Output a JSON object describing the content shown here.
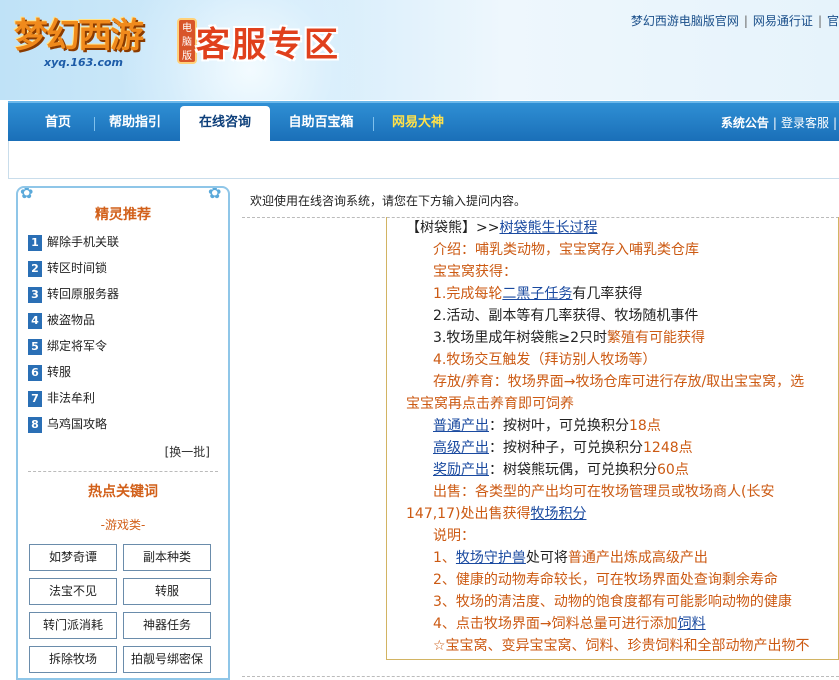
{
  "header": {
    "logo_text": "梦幻西游",
    "logo_url": "xyq.163.com",
    "logo_badge": "电脑版",
    "zone_title": "客服专区",
    "top_links": [
      "梦幻西游电脑版官网",
      "网易通行证",
      "官"
    ]
  },
  "nav": {
    "tabs": [
      {
        "label": "首页"
      },
      {
        "label": "帮助指引"
      },
      {
        "label": "在线咨询"
      },
      {
        "label": "自助百宝箱"
      },
      {
        "label": "网易大神"
      }
    ],
    "active_tab": "在线咨询",
    "right_links": [
      "系统公告",
      "登录客服"
    ]
  },
  "sidebar": {
    "sprite_title": "精灵推荐",
    "recommendations": [
      {
        "num": "1",
        "label": "解除手机关联"
      },
      {
        "num": "2",
        "label": "转区时间锁"
      },
      {
        "num": "3",
        "label": "转回原服务器"
      },
      {
        "num": "4",
        "label": "被盗物品"
      },
      {
        "num": "5",
        "label": "绑定将军令"
      },
      {
        "num": "6",
        "label": "转服"
      },
      {
        "num": "7",
        "label": "非法牟利"
      },
      {
        "num": "8",
        "label": "乌鸡国攻略"
      }
    ],
    "refresh_label": "[换一批]",
    "hot_title": "热点关键词",
    "game_category": "-游戏类-",
    "keywords": [
      "如梦奇谭",
      "副本种类",
      "法宝不见",
      "转服",
      "转门派消耗",
      "神器任务",
      "拆除牧场",
      "拍靓号绑密保"
    ]
  },
  "main": {
    "welcome": "欢迎使用在线咨询系统，请您在下方输入提问内容。",
    "answer": {
      "l1a": "【树袋熊】>>",
      "l1b": "树袋熊生长过程",
      "l2": "介绍：哺乳类动物，宝宝窝存入哺乳类仓库",
      "l3": "宝宝窝获得：",
      "l4a": "1.完成每轮",
      "l4b": "二黑子任务",
      "l4c": "有几率获得",
      "l5": "2.活动、副本等有几率获得、牧场随机事件",
      "l6a": "3.牧场里成年树袋熊≥2只时",
      "l6b": "繁殖有可能获得",
      "l7": "4.牧场交互触发（拜访别人牧场等）",
      "l8": "存放/养育：牧场界面→牧场仓库可进行存放/取出宝宝窝，选",
      "l9": "宝宝窝再点击养育即可饲养",
      "l10a": "普通产出",
      "l10b": "：按树叶，可兑换积分",
      "l10c": "18点",
      "l11a": "高级产出",
      "l11b": "：按树种子，可兑换积分",
      "l11c": "1248点",
      "l12a": "奖励产出",
      "l12b": "：树袋熊玩偶，可兑换积分",
      "l12c": "60点",
      "l13": "出售：各类型的产出均可在牧场管理员或牧场商人(长安",
      "l14a": "147,17)处出售获得",
      "l14b": "牧场积分",
      "l15": "说明：",
      "l16a": "1、",
      "l16b": "牧场守护兽",
      "l16c": "处可将",
      "l16d": "普通产出炼成高级产出",
      "l17": "2、健康的动物寿命较长，可在牧场界面处查询剩余寿命",
      "l18": "3、牧场的清洁度、动物的饱食度都有可能影响动物的健康",
      "l19a": "4、点击牧场界面→饲料总量可进行添加",
      "l19b": "饲料",
      "l20": "☆宝宝窝、变异宝宝窝、饲料、珍贵饲料和全部动物产出物不"
    }
  },
  "colors": {
    "accent": "#2a6fb5",
    "orange": "#cc5a13",
    "link": "#1a4aa0",
    "nav": "#1a6fb8"
  }
}
